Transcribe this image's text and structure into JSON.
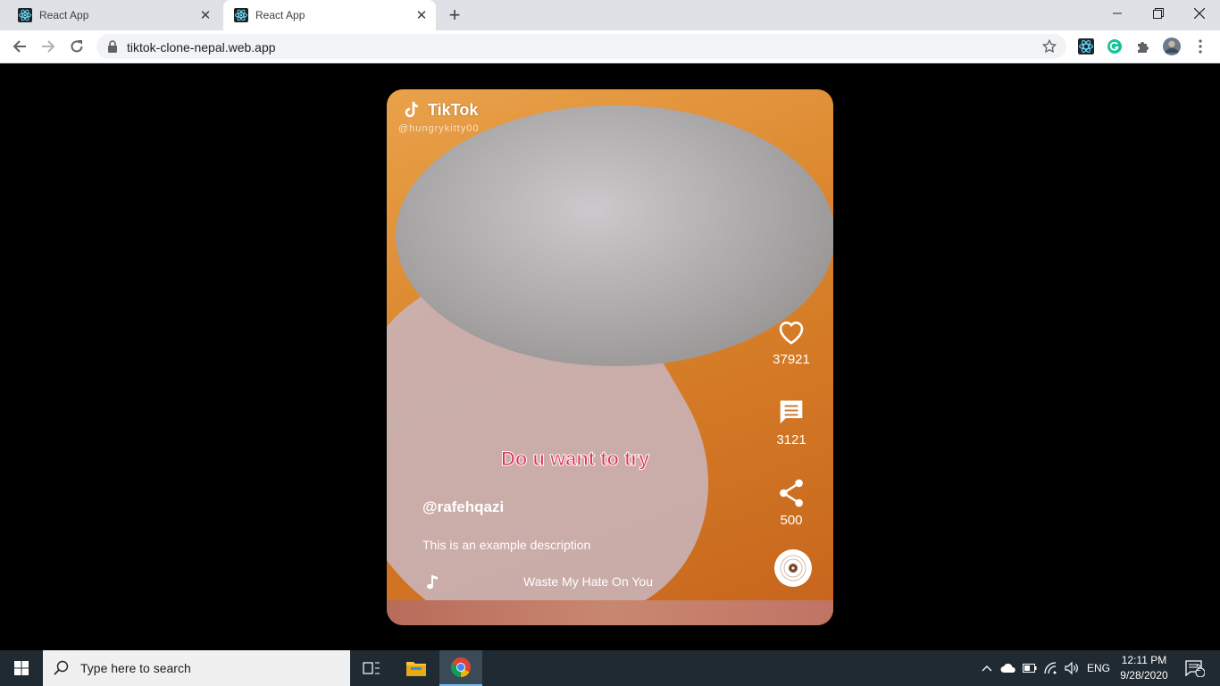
{
  "browser": {
    "tabs": [
      {
        "title": "React App",
        "active": false
      },
      {
        "title": "React App",
        "active": true
      }
    ],
    "url": "tiktok-clone-nepal.web.app"
  },
  "video": {
    "watermark_logo": "TikTok",
    "watermark_handle": "@hungrykitty00",
    "caption_overlay": "Do u want to try",
    "username": "@rafehqazi",
    "description": "This is an example description",
    "song": "Waste My Hate On You",
    "likes": "37921",
    "comments": "3121",
    "shares": "500"
  },
  "taskbar": {
    "search_placeholder": "Type here to search",
    "language": "ENG",
    "time": "12:11 PM",
    "date": "9/28/2020",
    "notifications": "2"
  },
  "colors": {
    "caption": "#e2335f",
    "taskbar": "#1f2a33",
    "tabstrip": "#dee1e6"
  }
}
